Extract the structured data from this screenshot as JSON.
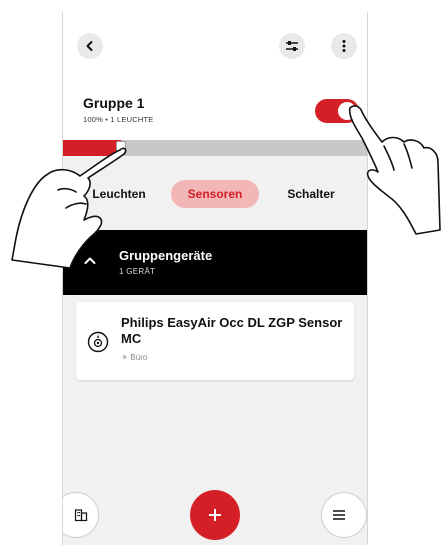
{
  "group": {
    "title": "Gruppe 1",
    "status": "100% • 1 LEUCHTE",
    "power_on": true,
    "brightness_percent": 100
  },
  "tabs": [
    {
      "label": "Leuchten",
      "active": false
    },
    {
      "label": "Sensoren",
      "active": true
    },
    {
      "label": "Schalter",
      "active": false
    }
  ],
  "devices_section": {
    "title": "Gruppengeräte",
    "count_label": "1 GERÄT"
  },
  "device": {
    "name": "Philips EasyAir Occ DL ZGP Sensor MC",
    "room": "Büro",
    "icon": "sensor-icon"
  },
  "icons": {
    "back": "chevron-left-icon",
    "settings": "sliders-icon",
    "more": "more-vertical-icon",
    "building": "building-icon",
    "add": "plus-icon",
    "menu": "menu-icon"
  },
  "colors": {
    "accent": "#d31f25",
    "active_tab_bg": "#f2b6b7",
    "header_bg": "#000000",
    "app_bg": "#f1f1f1"
  }
}
